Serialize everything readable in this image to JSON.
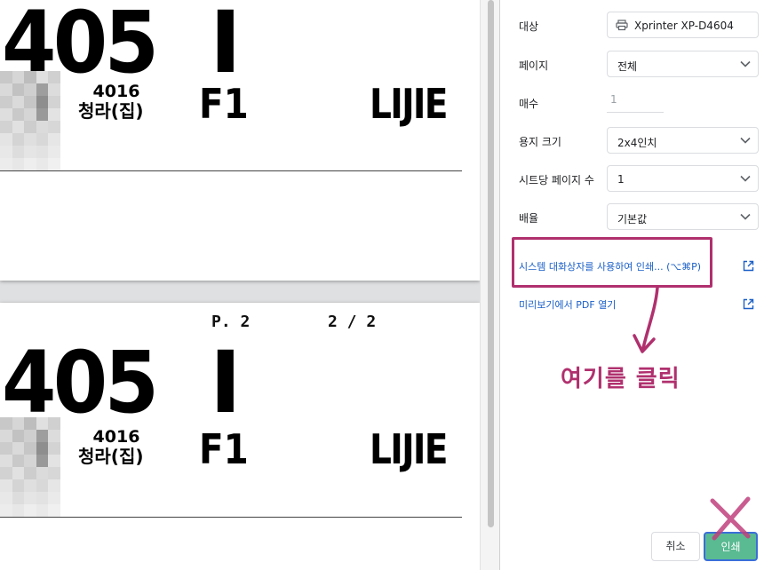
{
  "preview": {
    "pages": [
      {
        "big_number": "405",
        "big_letter": "I",
        "code": "4016",
        "name": "청라(집)",
        "floor": "F1",
        "brand": "LIJIE"
      },
      {
        "page_label": "P. 2",
        "page_count": "2 / 2",
        "big_number": "405",
        "big_letter": "I",
        "code": "4016",
        "name": "청라(집)",
        "floor": "F1",
        "brand": "LIJIE"
      }
    ]
  },
  "settings": {
    "destination": {
      "label": "대상",
      "value": "Xprinter XP-D4604"
    },
    "pages": {
      "label": "페이지",
      "value": "전체"
    },
    "copies": {
      "label": "매수",
      "value": "1"
    },
    "paper_size": {
      "label": "용지 크기",
      "value": "2x4인치"
    },
    "pages_per_sheet": {
      "label": "시트당 페이지 수",
      "value": "1"
    },
    "scale": {
      "label": "배율",
      "value": "기본값"
    },
    "system_dialog_link": "시스템 대화상자를 사용하여 인쇄... (⌥⌘P)",
    "open_pdf_link": "미리보기에서 PDF 열기",
    "cancel_label": "취소",
    "print_label": "인쇄"
  },
  "annotation": {
    "text": "여기를 클릭",
    "color": "#b0306e"
  },
  "colors": {
    "link": "#1a5fc7",
    "print_button": "#5aba92",
    "print_button_border": "#3a6ed8"
  }
}
